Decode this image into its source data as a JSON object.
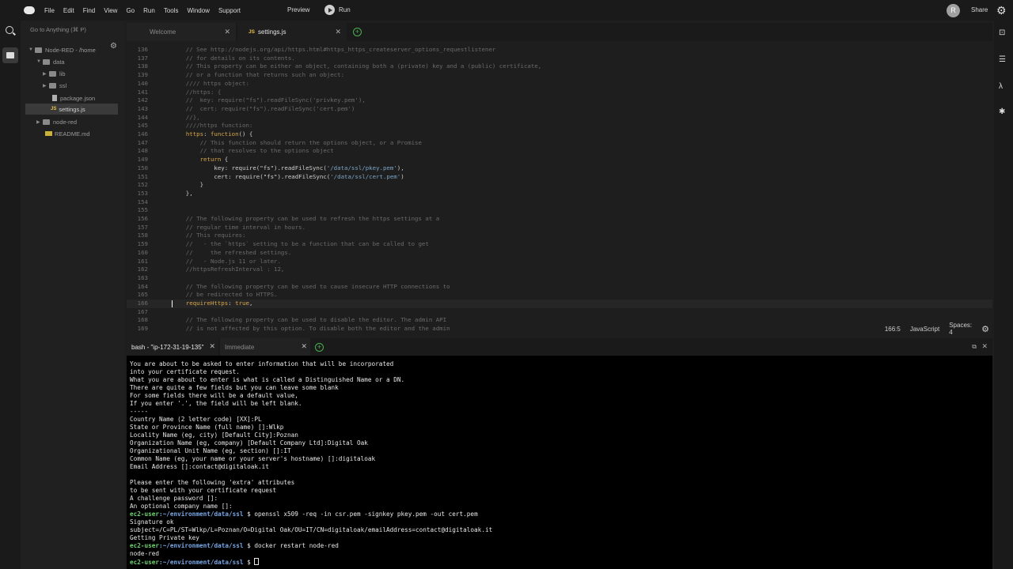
{
  "menubar": {
    "items": [
      "File",
      "Edit",
      "Find",
      "View",
      "Go",
      "Run",
      "Tools",
      "Window",
      "Support"
    ],
    "preview": "Preview",
    "run": "Run",
    "avatar_letter": "R",
    "share": "Share"
  },
  "sidebar": {
    "goto_placeholder": "Go to Anything (⌘ P)",
    "tree": [
      {
        "label": "Node-RED - /home",
        "kind": "folder",
        "expanded": true
      },
      {
        "label": "data",
        "kind": "folder",
        "expanded": true
      },
      {
        "label": "lib",
        "kind": "folder",
        "expanded": false
      },
      {
        "label": "ssl",
        "kind": "folder",
        "expanded": false
      },
      {
        "label": "package.json",
        "kind": "file"
      },
      {
        "label": "settings.js",
        "kind": "js",
        "selected": true
      },
      {
        "label": "node-red",
        "kind": "folder",
        "expanded": false
      },
      {
        "label": "README.md",
        "kind": "md"
      }
    ]
  },
  "editor": {
    "tabs": [
      {
        "label": "Welcome",
        "active": false
      },
      {
        "label": "settings.js",
        "active": true,
        "icon": "JS"
      }
    ],
    "lines": [
      {
        "n": "136",
        "t": "    // See http://nodejs.org/api/https.html#https_https_createserver_options_requestlistener"
      },
      {
        "n": "137",
        "t": "    // for details on its contents."
      },
      {
        "n": "138",
        "t": "    // This property can be either an object, containing both a (private) key and a (public) certificate,"
      },
      {
        "n": "139",
        "t": "    // or a function that returns such an object:"
      },
      {
        "n": "140",
        "t": "    //// https object:"
      },
      {
        "n": "141",
        "t": "    //https: {"
      },
      {
        "n": "142",
        "t": "    //  key: require(\"fs\").readFileSync('privkey.pem'),"
      },
      {
        "n": "143",
        "t": "    //  cert: require(\"fs\").readFileSync('cert.pem')"
      },
      {
        "n": "144",
        "t": "    //},"
      },
      {
        "n": "145",
        "t": "    ////https function:"
      },
      {
        "n": "146",
        "t": "    https: function() {"
      },
      {
        "n": "147",
        "t": "        // This function should return the options object, or a Promise"
      },
      {
        "n": "148",
        "t": "        // that resolves to the options object"
      },
      {
        "n": "149",
        "t": "        return {"
      },
      {
        "n": "150",
        "t": "            key: require(\"fs\").readFileSync('/data/ssl/pkey.pem'),"
      },
      {
        "n": "151",
        "t": "            cert: require(\"fs\").readFileSync('/data/ssl/cert.pem')"
      },
      {
        "n": "152",
        "t": "        }"
      },
      {
        "n": "153",
        "t": "    },"
      },
      {
        "n": "154",
        "t": ""
      },
      {
        "n": "155",
        "t": ""
      },
      {
        "n": "156",
        "t": "    // The following property can be used to refresh the https settings at a"
      },
      {
        "n": "157",
        "t": "    // regular time interval in hours."
      },
      {
        "n": "158",
        "t": "    // This requires:"
      },
      {
        "n": "159",
        "t": "    //   - the `https` setting to be a function that can be called to get"
      },
      {
        "n": "160",
        "t": "    //     the refreshed settings."
      },
      {
        "n": "161",
        "t": "    //   - Node.js 11 or later."
      },
      {
        "n": "162",
        "t": "    //httpsRefreshInterval : 12,"
      },
      {
        "n": "163",
        "t": ""
      },
      {
        "n": "164",
        "t": "    // The following property can be used to cause insecure HTTP connections to"
      },
      {
        "n": "165",
        "t": "    // be redirected to HTTPS."
      },
      {
        "n": "166",
        "t": "    requireHttps: true,"
      },
      {
        "n": "167",
        "t": ""
      },
      {
        "n": "168",
        "t": "    // The following property can be used to disable the editor. The admin API"
      },
      {
        "n": "169",
        "t": "    // is not affected by this option. To disable both the editor and the admin"
      }
    ],
    "status": {
      "position": "166:5",
      "language": "JavaScript",
      "spaces": "Spaces: 4"
    }
  },
  "terminal": {
    "tabs": [
      {
        "label": "bash - \"ip-172-31-19-135\"",
        "active": true
      },
      {
        "label": "Immediate",
        "active": false
      }
    ],
    "prompt_user": "ec2-user",
    "prompt_path": ":~/environment/data/ssl",
    "lines": [
      {
        "type": "out",
        "t": "You are about to be asked to enter information that will be incorporated"
      },
      {
        "type": "out",
        "t": "into your certificate request."
      },
      {
        "type": "out",
        "t": "What you are about to enter is what is called a Distinguished Name or a DN."
      },
      {
        "type": "out",
        "t": "There are quite a few fields but you can leave some blank"
      },
      {
        "type": "out",
        "t": "For some fields there will be a default value,"
      },
      {
        "type": "out",
        "t": "If you enter '.', the field will be left blank."
      },
      {
        "type": "out",
        "t": "-----"
      },
      {
        "type": "out",
        "t": "Country Name (2 letter code) [XX]:PL"
      },
      {
        "type": "out",
        "t": "State or Province Name (full name) []:Wlkp"
      },
      {
        "type": "out",
        "t": "Locality Name (eg, city) [Default City]:Poznan"
      },
      {
        "type": "out",
        "t": "Organization Name (eg, company) [Default Company Ltd]:Digital Oak"
      },
      {
        "type": "out",
        "t": "Organizational Unit Name (eg, section) []:IT"
      },
      {
        "type": "out",
        "t": "Common Name (eg, your name or your server's hostname) []:digitaloak"
      },
      {
        "type": "out",
        "t": "Email Address []:contact@digitaloak.it"
      },
      {
        "type": "out",
        "t": ""
      },
      {
        "type": "out",
        "t": "Please enter the following 'extra' attributes"
      },
      {
        "type": "out",
        "t": "to be sent with your certificate request"
      },
      {
        "type": "out",
        "t": "A challenge password []:"
      },
      {
        "type": "out",
        "t": "An optional company name []:"
      },
      {
        "type": "cmd",
        "t": " $ openssl x509 -req -in csr.pem -signkey pkey.pem -out cert.pem"
      },
      {
        "type": "out",
        "t": "Signature ok"
      },
      {
        "type": "out",
        "t": "subject=/C=PL/ST=Wlkp/L=Poznan/O=Digital Oak/OU=IT/CN=digitaloak/emailAddress=contact@digitaloak.it"
      },
      {
        "type": "out",
        "t": "Getting Private key"
      },
      {
        "type": "cmd",
        "t": " $ docker restart node-red"
      },
      {
        "type": "out",
        "t": "node-red"
      },
      {
        "type": "cmd",
        "t": " $ "
      }
    ]
  }
}
